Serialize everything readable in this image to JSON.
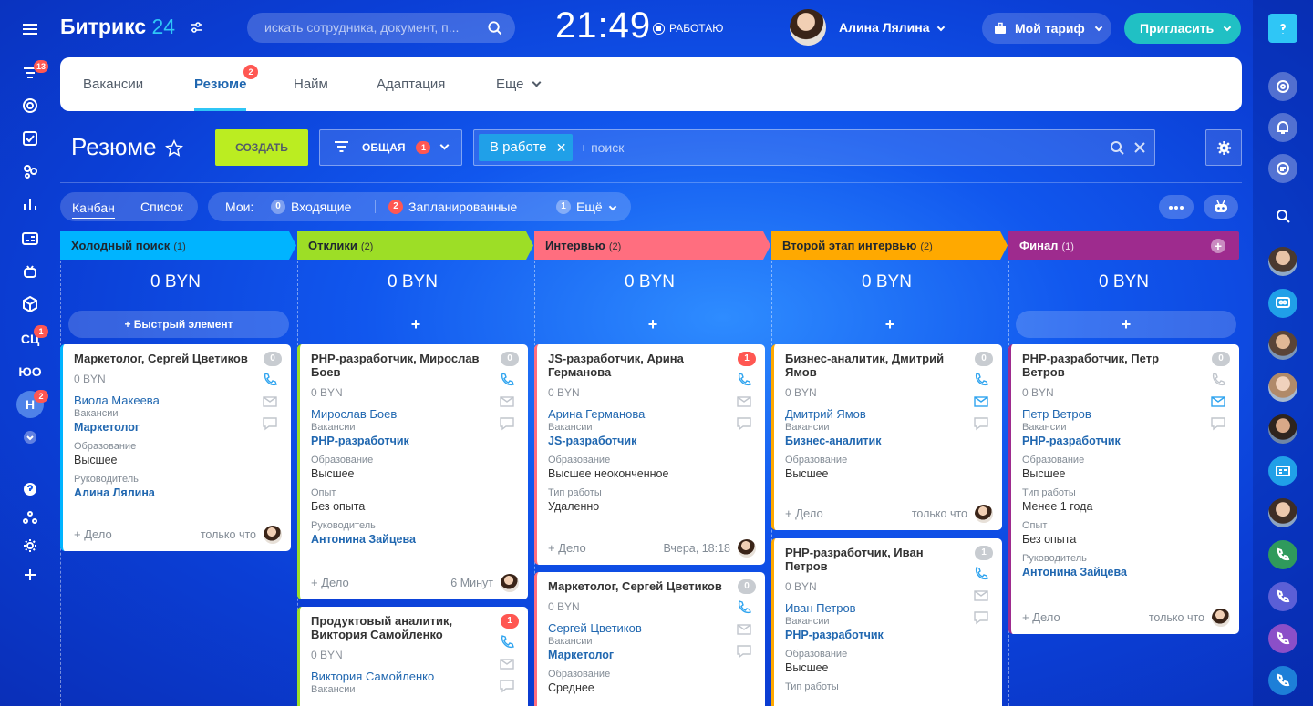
{
  "sidebar": {
    "badges": {
      "feed": "13",
      "sc": "1",
      "n": "2"
    },
    "labels": {
      "sc": "СЦ",
      "yo": "ЮО",
      "n": "Н"
    }
  },
  "header": {
    "logo_text": "Битрикс",
    "logo_num": "24",
    "search_placeholder": "искать сотрудника, документ, п...",
    "clock": "21:49",
    "work_status": "РАБОТАЮ",
    "user_name": "Алина Лялина",
    "tariff_label": "Мой тариф",
    "invite_label": "Пригласить"
  },
  "tabs": [
    {
      "label": "Вакансии"
    },
    {
      "label": "Резюме",
      "badge": "2"
    },
    {
      "label": "Найм"
    },
    {
      "label": "Адаптация"
    },
    {
      "label": "Еще"
    }
  ],
  "toolbar": {
    "page_title": "Резюме",
    "create_label": "СОЗДАТЬ",
    "preset_label": "ОБЩАЯ",
    "preset_count": "1",
    "filter_chip": "В работе",
    "search_placeholder": "+ поиск"
  },
  "views": {
    "kanban": "Канбан",
    "list": "Список"
  },
  "counters": {
    "mine_label": "Мои:",
    "incoming_count": "0",
    "incoming_label": "Входящие",
    "planned_count": "2",
    "planned_label": "Запланированные",
    "more_count": "1",
    "more_label": "Ещё"
  },
  "colors": {
    "cold": "#00b4ff",
    "responses": "#9dde26",
    "interview": "#ff6e7f",
    "second": "#ffa900",
    "final": "#9e2b8e"
  },
  "columns": [
    {
      "title": "Холодный поиск",
      "count": "(1)",
      "sum": "0 BYN",
      "quick": "+ Быстрый элемент",
      "cards": [
        {
          "title": "Маркетолог, Сергей Цветиков",
          "badge": "0",
          "sum": "0 BYN",
          "contact": "Виола Макеева",
          "f1_label": "Вакансии",
          "f1_value": "Маркетолог",
          "f2_label": "Образование",
          "f2_value": "Высшее",
          "f3_label": "Руководитель",
          "f3_value": "Алина Лялина",
          "add": "+ Дело",
          "time": "только что"
        }
      ]
    },
    {
      "title": "Отклики",
      "count": "(2)",
      "sum": "0 BYN",
      "quick": "+",
      "cards": [
        {
          "title": "PHP-разработчик, Мирослав Боев",
          "badge": "0",
          "sum": "0 BYN",
          "contact": "Мирослав Боев",
          "f1_label": "Вакансии",
          "f1_value": "PHP-разработчик",
          "f2_label": "Образование",
          "f2_value": "Высшее",
          "f3_label": "Опыт",
          "f3_value": "Без опыта",
          "f4_label": "Руководитель",
          "f4_value": "Антонина Зайцева",
          "add": "+ Дело",
          "time": "6 Минут"
        },
        {
          "title": "Продуктовый аналитик, Виктория Самойленко",
          "badge": "1",
          "sum": "0 BYN",
          "contact": "Виктория Самойленко",
          "f1_label": "Вакансии"
        }
      ]
    },
    {
      "title": "Интервью",
      "count": "(2)",
      "sum": "0 BYN",
      "quick": "+",
      "cards": [
        {
          "title": "JS-разработчик, Арина Германова",
          "badge": "1",
          "sum": "0 BYN",
          "contact": "Арина Германова",
          "f1_label": "Вакансии",
          "f1_value": "JS-разработчик",
          "f2_label": "Образование",
          "f2_value": "Высшее неоконченное",
          "f3_label": "Тип работы",
          "f3_value": "Удаленно",
          "add": "+ Дело",
          "time": "Вчера, 18:18"
        },
        {
          "title": "Маркетолог, Сергей Цветиков",
          "badge": "0",
          "sum": "0 BYN",
          "contact": "Сергей Цветиков",
          "f1_label": "Вакансии",
          "f1_value": "Маркетолог",
          "f2_label": "Образование",
          "f2_value": "Среднее"
        }
      ]
    },
    {
      "title": "Второй этап интервью",
      "count": "(2)",
      "sum": "0 BYN",
      "quick": "+",
      "cards": [
        {
          "title": "Бизнес-аналитик, Дмитрий Ямов",
          "badge": "0",
          "sum": "0 BYN",
          "contact": "Дмитрий Ямов",
          "f1_label": "Вакансии",
          "f1_value": "Бизнес-аналитик",
          "f2_label": "Образование",
          "f2_value": "Высшее",
          "add": "+ Дело",
          "time": "только что"
        },
        {
          "title": "PHP-разработчик, Иван Петров",
          "badge": "1",
          "sum": "0 BYN",
          "contact": "Иван Петров",
          "f1_label": "Вакансии",
          "f1_value": "PHP-разработчик",
          "f2_label": "Образование",
          "f2_value": "Высшее",
          "f3_label": "Тип работы"
        }
      ]
    },
    {
      "title": "Финал",
      "count": "(1)",
      "sum": "0 BYN",
      "quick": "+",
      "cards": [
        {
          "title": "PHP-разработчик, Петр Ветров",
          "badge": "0",
          "sum": "0 BYN",
          "contact": "Петр Ветров",
          "f1_label": "Вакансии",
          "f1_value": "PHP-разработчик",
          "f2_label": "Образование",
          "f2_value": "Высшее",
          "f3_label": "Тип работы",
          "f3_value": "Менее 1 года",
          "f4_label": "Опыт",
          "f4_value": "Без опыта",
          "f5_label": "Руководитель",
          "f5_value": "Антонина Зайцева",
          "add": "+ Дело",
          "time": "только что"
        }
      ]
    }
  ]
}
